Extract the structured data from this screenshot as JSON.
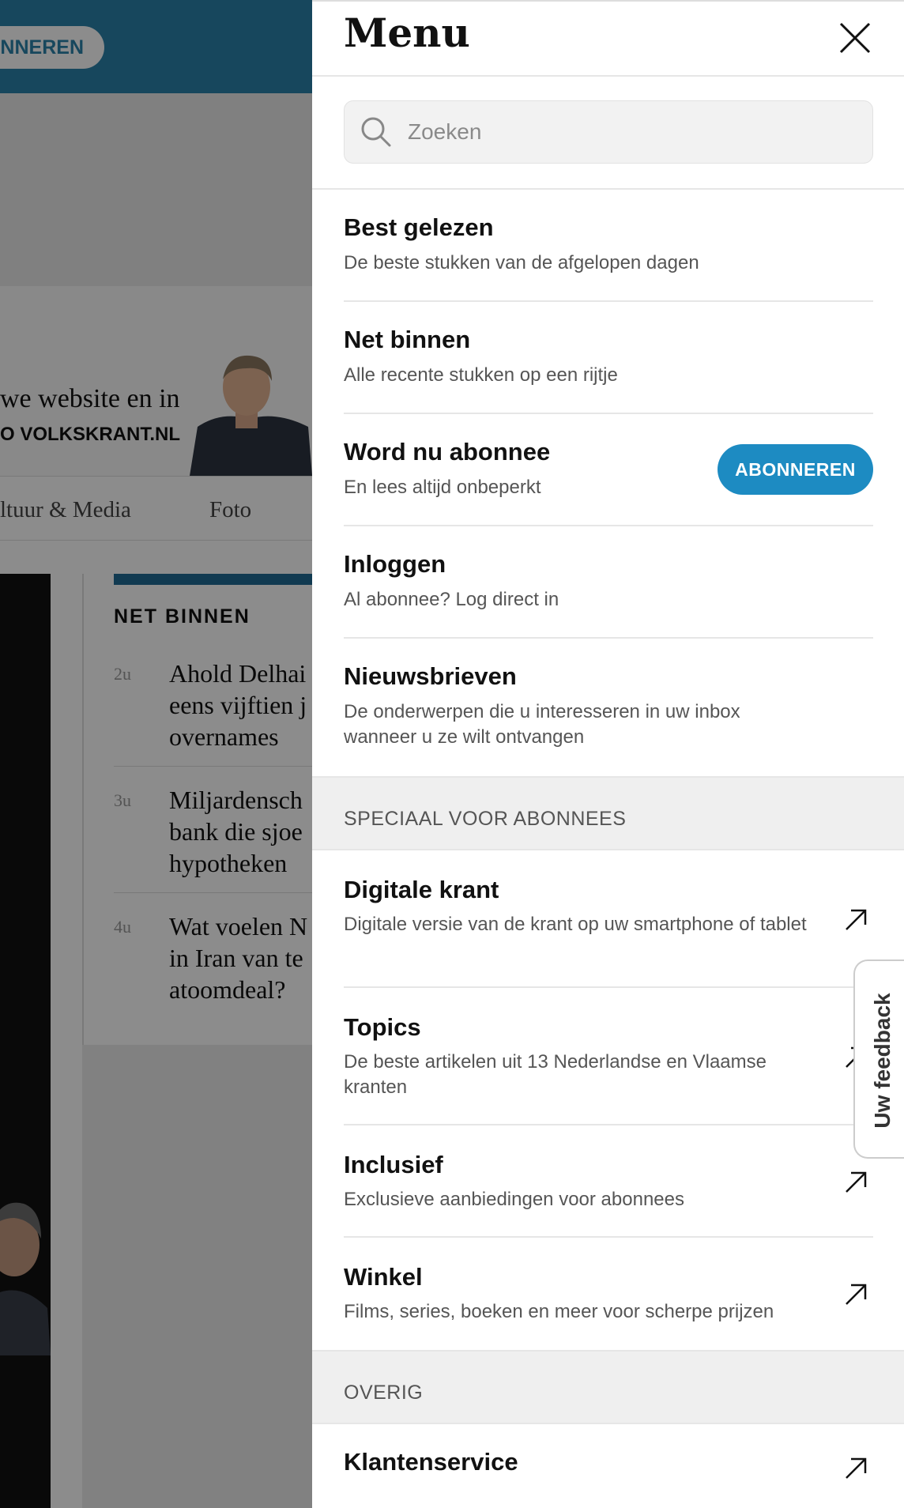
{
  "background": {
    "subscribe_label": "ONNEREN",
    "promo_line1": "we website en in",
    "promo_line2": "O  VOLKSKRANT.NL",
    "nav": [
      "ltuur & Media",
      "Foto"
    ],
    "feed_title": "NET BINNEN",
    "feed": [
      {
        "time": "2u",
        "text": "Ahold Delhai\neens vijftien j\novernames"
      },
      {
        "time": "3u",
        "text": "Miljardensch\nbank die sjoe\nhypotheken"
      },
      {
        "time": "4u",
        "text": "Wat voelen N\nin Iran van te\natoomdeal?"
      }
    ]
  },
  "menu": {
    "title": "Menu",
    "search_placeholder": "Zoeken",
    "items": [
      {
        "title": "Best gelezen",
        "subtitle": "De beste stukken van de afgelopen dagen"
      },
      {
        "title": "Net binnen",
        "subtitle": "Alle recente stukken op een rijtje"
      },
      {
        "title": "Word nu abonnee",
        "subtitle": "En lees altijd onbeperkt",
        "button": "ABONNEREN"
      },
      {
        "title": "Inloggen",
        "subtitle": "Al abonnee? Log direct in"
      },
      {
        "title": "Nieuwsbrieven",
        "subtitle": "De onderwerpen die u interesseren in uw inbox wanneer u ze wilt ontvangen"
      }
    ],
    "section_subscribers": "SPECIAAL VOOR ABONNEES",
    "subscriber_items": [
      {
        "title": "Digitale krant",
        "subtitle": "Digitale versie van de krant op uw smartphone of tablet",
        "icon": "external-arrow-icon"
      },
      {
        "title": "Topics",
        "subtitle": "De beste artikelen uit 13 Nederlandse en Vlaamse kranten",
        "icon": "external-arrow-icon"
      },
      {
        "title": "Inclusief",
        "subtitle": "Exclusieve aanbiedingen voor abonnees",
        "icon": "external-arrow-icon"
      },
      {
        "title": "Winkel",
        "subtitle": "Films, series, boeken en meer voor scherpe prijzen",
        "icon": "external-arrow-icon"
      }
    ],
    "section_other": "OVERIG",
    "other_items": [
      {
        "title": "Klantenservice",
        "icon": "external-arrow-icon"
      }
    ]
  },
  "feedback_label": "Uw feedback",
  "colors": {
    "accent": "#1d8bc2",
    "header_blue": "#2a82aa"
  }
}
